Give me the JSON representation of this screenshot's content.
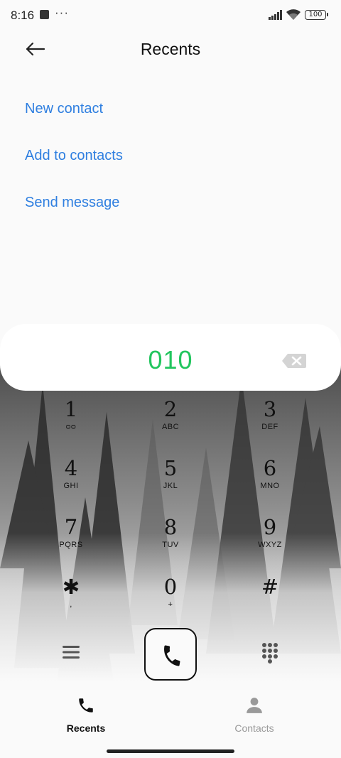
{
  "status_bar": {
    "time": "8:16",
    "more": "···",
    "battery": "100"
  },
  "header": {
    "title": "Recents",
    "back_icon": "arrow-left-icon"
  },
  "actions": [
    {
      "label": "New contact"
    },
    {
      "label": "Add to contacts"
    },
    {
      "label": "Send message"
    }
  ],
  "dialer": {
    "number": "010",
    "number_color": "#22c55e",
    "backspace_icon": "backspace-icon",
    "keys": [
      {
        "digit": "1",
        "letters": "ᴑᴑ"
      },
      {
        "digit": "2",
        "letters": "ABC"
      },
      {
        "digit": "3",
        "letters": "DEF"
      },
      {
        "digit": "4",
        "letters": "GHI"
      },
      {
        "digit": "5",
        "letters": "JKL"
      },
      {
        "digit": "6",
        "letters": "MNO"
      },
      {
        "digit": "7",
        "letters": "PQRS"
      },
      {
        "digit": "8",
        "letters": "TUV"
      },
      {
        "digit": "9",
        "letters": "WXYZ"
      },
      {
        "digit": "✱",
        "letters": ","
      },
      {
        "digit": "0",
        "letters": "+"
      },
      {
        "digit": "#",
        "letters": ""
      }
    ]
  },
  "controls": {
    "menu_icon": "menu-icon",
    "call_icon": "phone-icon",
    "keypad_icon": "keypad-icon"
  },
  "nav": {
    "recents": {
      "label": "Recents",
      "icon": "phone-icon"
    },
    "contacts": {
      "label": "Contacts",
      "icon": "person-icon"
    }
  },
  "colors": {
    "accent_link": "#2f7fe0",
    "dialed_number": "#22c55e"
  }
}
